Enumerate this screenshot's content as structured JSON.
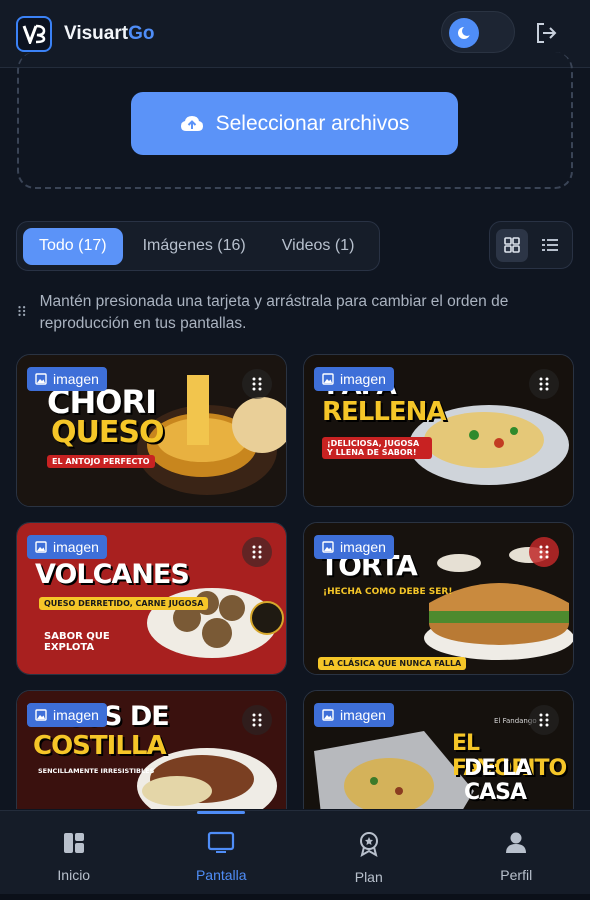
{
  "header": {
    "brand_part1": "Visuart",
    "brand_part2": "Go",
    "accent_color": "#4f8df7",
    "theme_icon": "moon-icon",
    "logout_icon": "logout-icon"
  },
  "upload": {
    "button_label": "Seleccionar archivos",
    "icon": "cloud-upload-icon"
  },
  "filters": {
    "tabs": [
      {
        "label": "Todo (17)",
        "active": true
      },
      {
        "label": "Imágenes (16)",
        "active": false
      },
      {
        "label": "Videos (1)",
        "active": false
      }
    ],
    "view_modes": [
      "grid-icon",
      "list-icon"
    ]
  },
  "hint": {
    "text": "Mantén presionada una tarjeta y arrástrala para cambiar el orden de reproducción en tus pantallas."
  },
  "cards": [
    {
      "badge": "imagen",
      "title_line1": "CHORI",
      "title_line2": "QUESO",
      "tag": "EL ANTOJO PERFECTO"
    },
    {
      "badge": "imagen",
      "title_line1": "PAPA",
      "title_line2": "RELLENA",
      "tag": "¡DELICIOSA, JUGOSA Y LLENA DE SABOR!"
    },
    {
      "badge": "imagen",
      "title_line1": "VOLCANES",
      "title_line2": "SABOR QUE EXPLOTA",
      "tag": "QUESO DERRETIDO, CARNE JUGOSA"
    },
    {
      "badge": "imagen",
      "title_line1": "TORTA",
      "title_line2": "¡HECHA COMO DEBE SER!",
      "tag": "LA CLÁSICA QUE NUNCA FALLA"
    },
    {
      "badge": "imagen",
      "title_line1": "TACOS DE",
      "title_line2": "COSTILLA",
      "tag": "SENCILLAMENTE IRRESISTIBLES"
    },
    {
      "badge": "imagen",
      "title_line1": "EL FAVORITO",
      "title_line2": "DE LA CASA",
      "tag": "El Fandango"
    }
  ],
  "nav": [
    {
      "label": "Inicio",
      "icon": "dashboard-icon",
      "active": false
    },
    {
      "label": "Pantalla",
      "icon": "monitor-icon",
      "active": true
    },
    {
      "label": "Plan",
      "icon": "award-icon",
      "active": false
    },
    {
      "label": "Perfil",
      "icon": "user-icon",
      "active": false
    }
  ]
}
